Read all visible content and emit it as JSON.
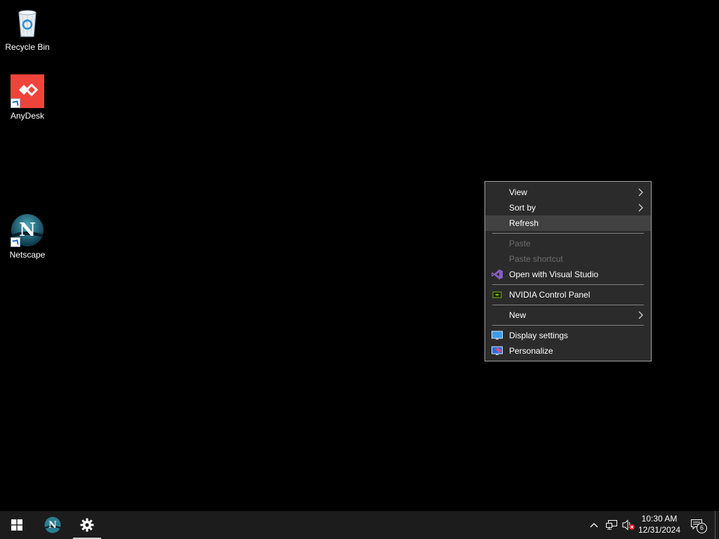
{
  "desktop": {
    "icons": [
      {
        "label": "Recycle Bin"
      },
      {
        "label": "AnyDesk"
      },
      {
        "label": "Netscape"
      }
    ]
  },
  "context_menu": {
    "items": {
      "view": "View",
      "sort_by": "Sort by",
      "refresh": "Refresh",
      "paste": "Paste",
      "paste_shortcut": "Paste shortcut",
      "open_vs": "Open with Visual Studio",
      "nvidia": "NVIDIA Control Panel",
      "new": "New",
      "display_settings": "Display settings",
      "personalize": "Personalize"
    }
  },
  "taskbar": {
    "clock_time": "10:30 AM",
    "clock_date": "12/31/2024",
    "notification_count": "6"
  },
  "colors": {
    "anydesk_red": "#ef443b",
    "vs_purple": "#865fc5",
    "nvidia_green": "#76b900"
  }
}
